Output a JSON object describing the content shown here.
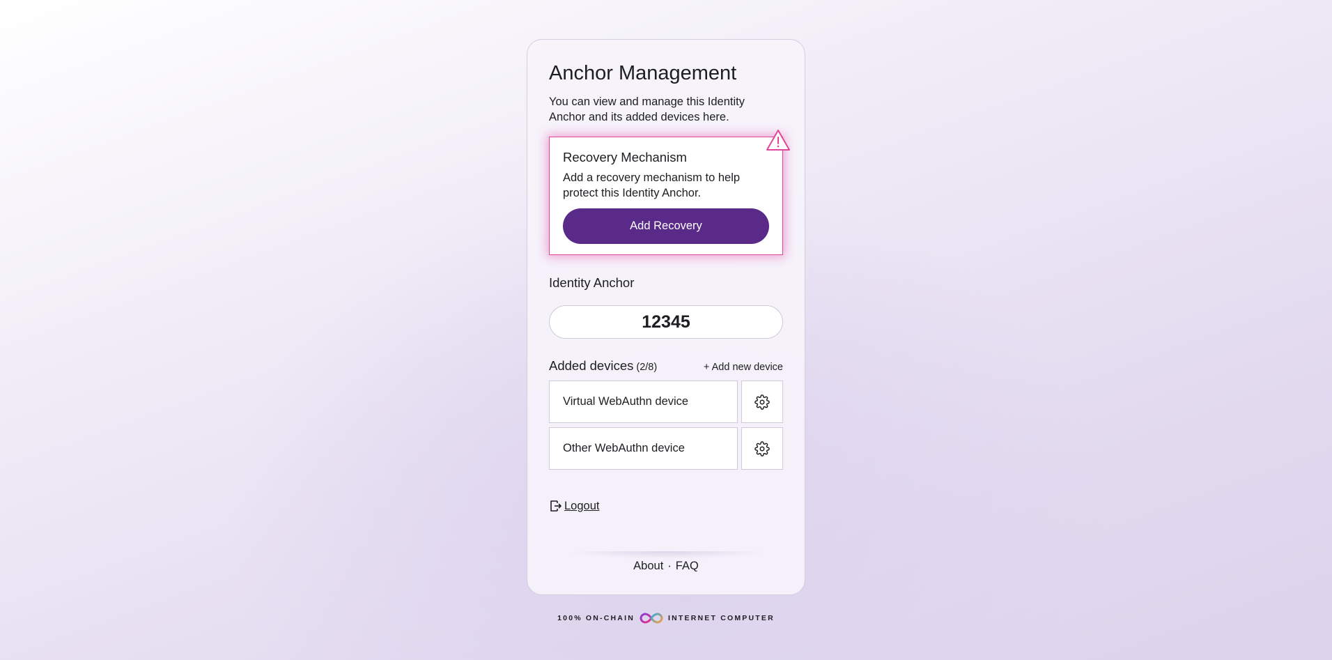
{
  "page": {
    "title": "Anchor Management",
    "subtitle": "You can view and manage this Identity Anchor and its added devices here."
  },
  "recovery": {
    "title": "Recovery Mechanism",
    "text": "Add a recovery mechanism to help protect this Identity Anchor.",
    "button_label": "Add Recovery",
    "icon": "warning-triangle-icon",
    "accent_color": "#e0479a"
  },
  "anchor": {
    "label": "Identity Anchor",
    "value": "12345"
  },
  "devices": {
    "title": "Added devices",
    "count": "(2/8)",
    "add_label": "+ Add new device",
    "items": [
      {
        "name": "Virtual WebAuthn device",
        "icon": "gear-icon"
      },
      {
        "name": "Other WebAuthn device",
        "icon": "gear-icon"
      }
    ]
  },
  "logout": {
    "label": "Logout",
    "icon": "logout-icon"
  },
  "footer": {
    "about": "About",
    "separator": "·",
    "faq": "FAQ"
  },
  "brand": {
    "left": "100% ON-CHAIN",
    "right": "INTERNET COMPUTER",
    "icon": "infinity-logo-icon"
  },
  "colors": {
    "primary": "#5a2a88",
    "warning": "#e0479a"
  }
}
